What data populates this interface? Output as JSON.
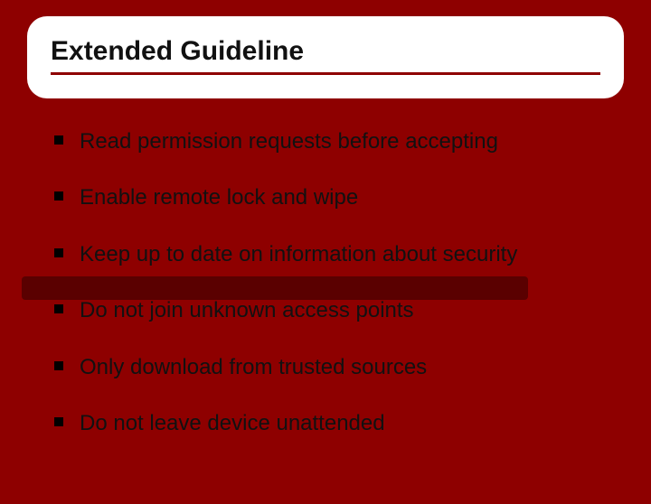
{
  "title": "Extended Guideline",
  "bullets": [
    "Read permission requests before accepting",
    "Enable remote lock and wipe",
    "Keep up to date on information about security",
    "Do not join unknown access points",
    "Only download from trusted sources",
    "Do not leave device unattended"
  ]
}
